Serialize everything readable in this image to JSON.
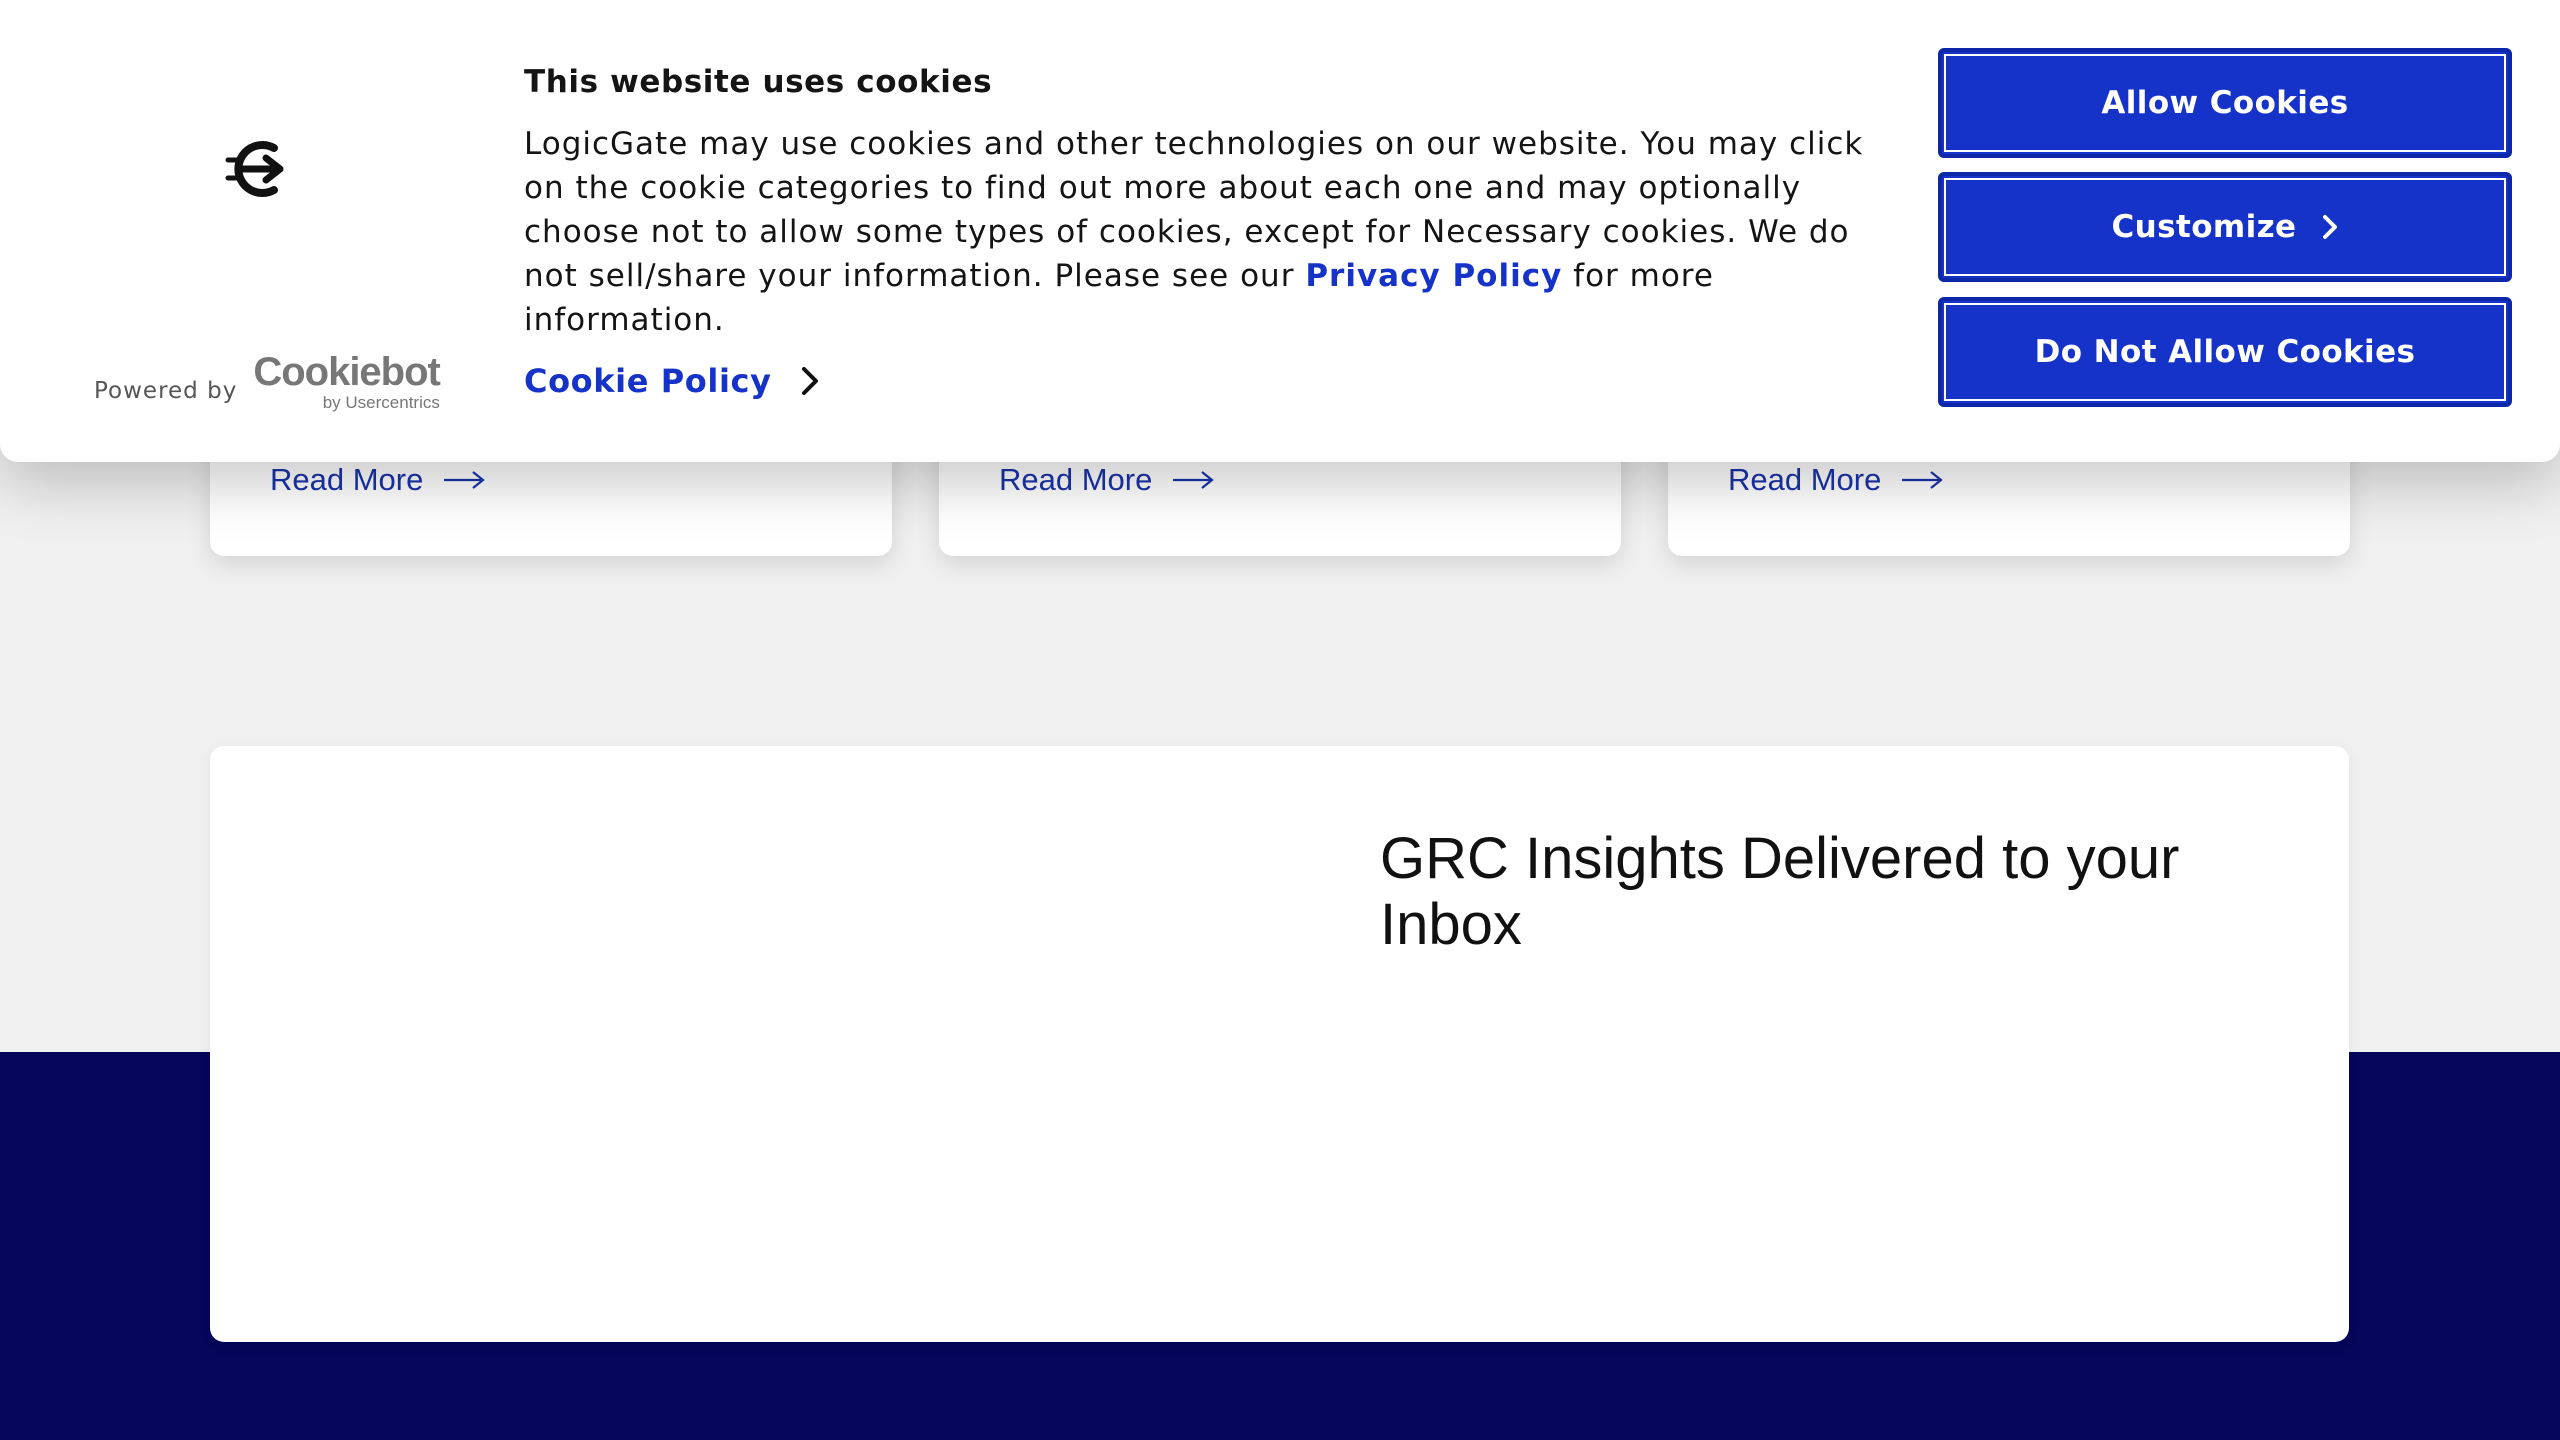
{
  "cookie_banner": {
    "title": "This website uses cookies",
    "body_text": "LogicGate may use cookies and other technologies on our website. You may click on the cookie categories to find out more about each one and may optionally choose not to allow some types of cookies, except for Necessary cookies.  We do not sell/share your information. Please see our ",
    "privacy_link": "Privacy Policy",
    "body_suffix": " for more information.",
    "cookie_policy_link": "Cookie Policy",
    "powered_by": "Powered by",
    "cookiebot_brand": "Cookiebot",
    "cookiebot_sub": "by Usercentrics",
    "buttons": {
      "allow": "Allow Cookies",
      "customize": "Customize",
      "deny": "Do Not Allow Cookies"
    },
    "accent_color": "#1532c9"
  },
  "cards": [
    {
      "read_more": "Read More"
    },
    {
      "read_more": "Read More"
    },
    {
      "read_more": "Read More"
    }
  ],
  "newsletter": {
    "title": "GRC Insights Delivered to your Inbox"
  },
  "colors": {
    "footer": "#06065a",
    "link": "#1a33aa",
    "page_bg": "#f0f0f0"
  }
}
